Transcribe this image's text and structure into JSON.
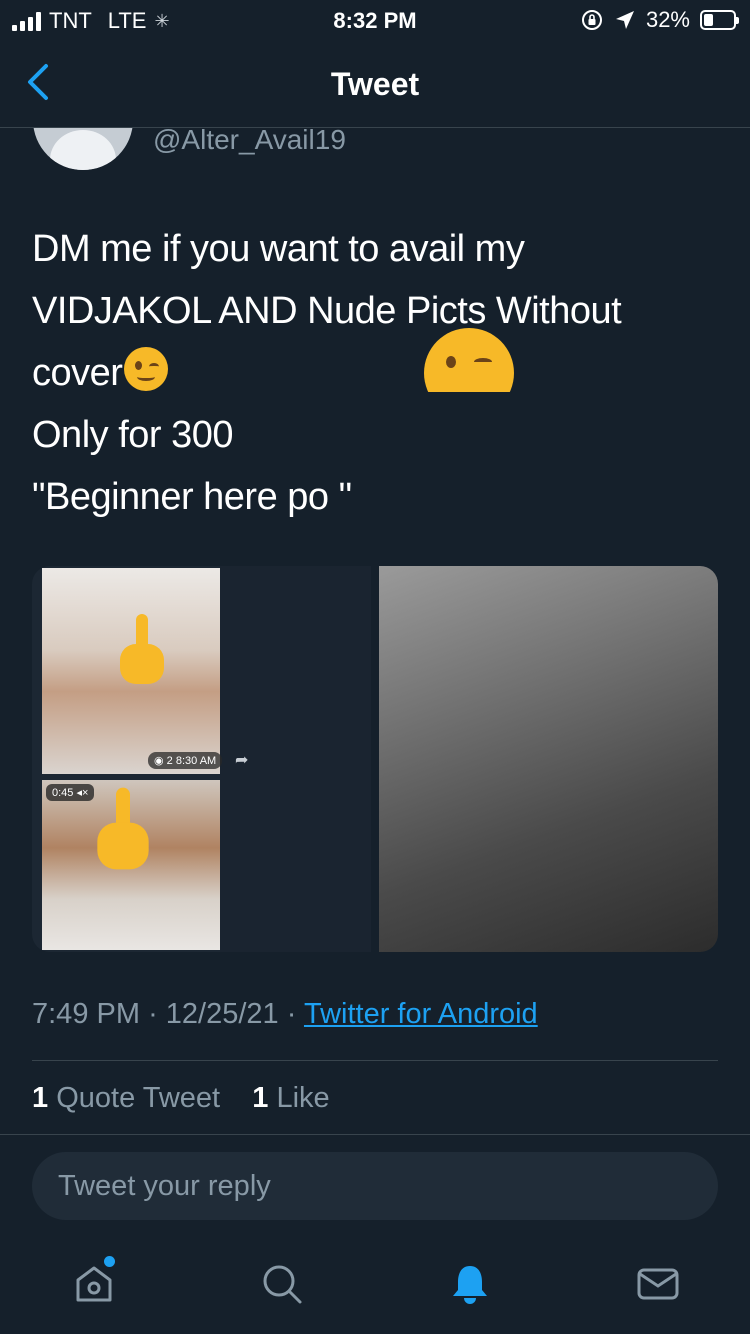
{
  "status_bar": {
    "carrier": "TNT",
    "network": "LTE",
    "time": "8:32 PM",
    "battery": "32%",
    "battery_level": 0.32
  },
  "header": {
    "title": "Tweet",
    "back_icon": "chevron-left-icon"
  },
  "author": {
    "handle": "@Alter_Avail19"
  },
  "tweet": {
    "lines": [
      "DM me if you want to avail my",
      "VIDJAKOL AND Nude Picts Without",
      "cover",
      "Only for 300",
      "\"Beginner here po \""
    ],
    "emoji": "winking-face-emoji"
  },
  "media": {
    "left_view_count": "2",
    "left_time": "8:30 AM",
    "left_duration": "0:45"
  },
  "meta": {
    "time": "7:49 PM",
    "date": "12/25/21",
    "separator": "·",
    "source": "Twitter for Android"
  },
  "counts": {
    "quote_count": "1",
    "quote_label": "Quote Tweet",
    "like_count": "1",
    "like_label": "Like"
  },
  "reply": {
    "placeholder": "Tweet your reply"
  },
  "tabbar": {
    "items": [
      "home-icon",
      "search-icon",
      "notifications-icon",
      "messages-icon"
    ],
    "accent": "#1da1f2"
  },
  "colors": {
    "background": "#15202b",
    "secondary_text": "#8899a6",
    "link": "#1da1f2"
  }
}
